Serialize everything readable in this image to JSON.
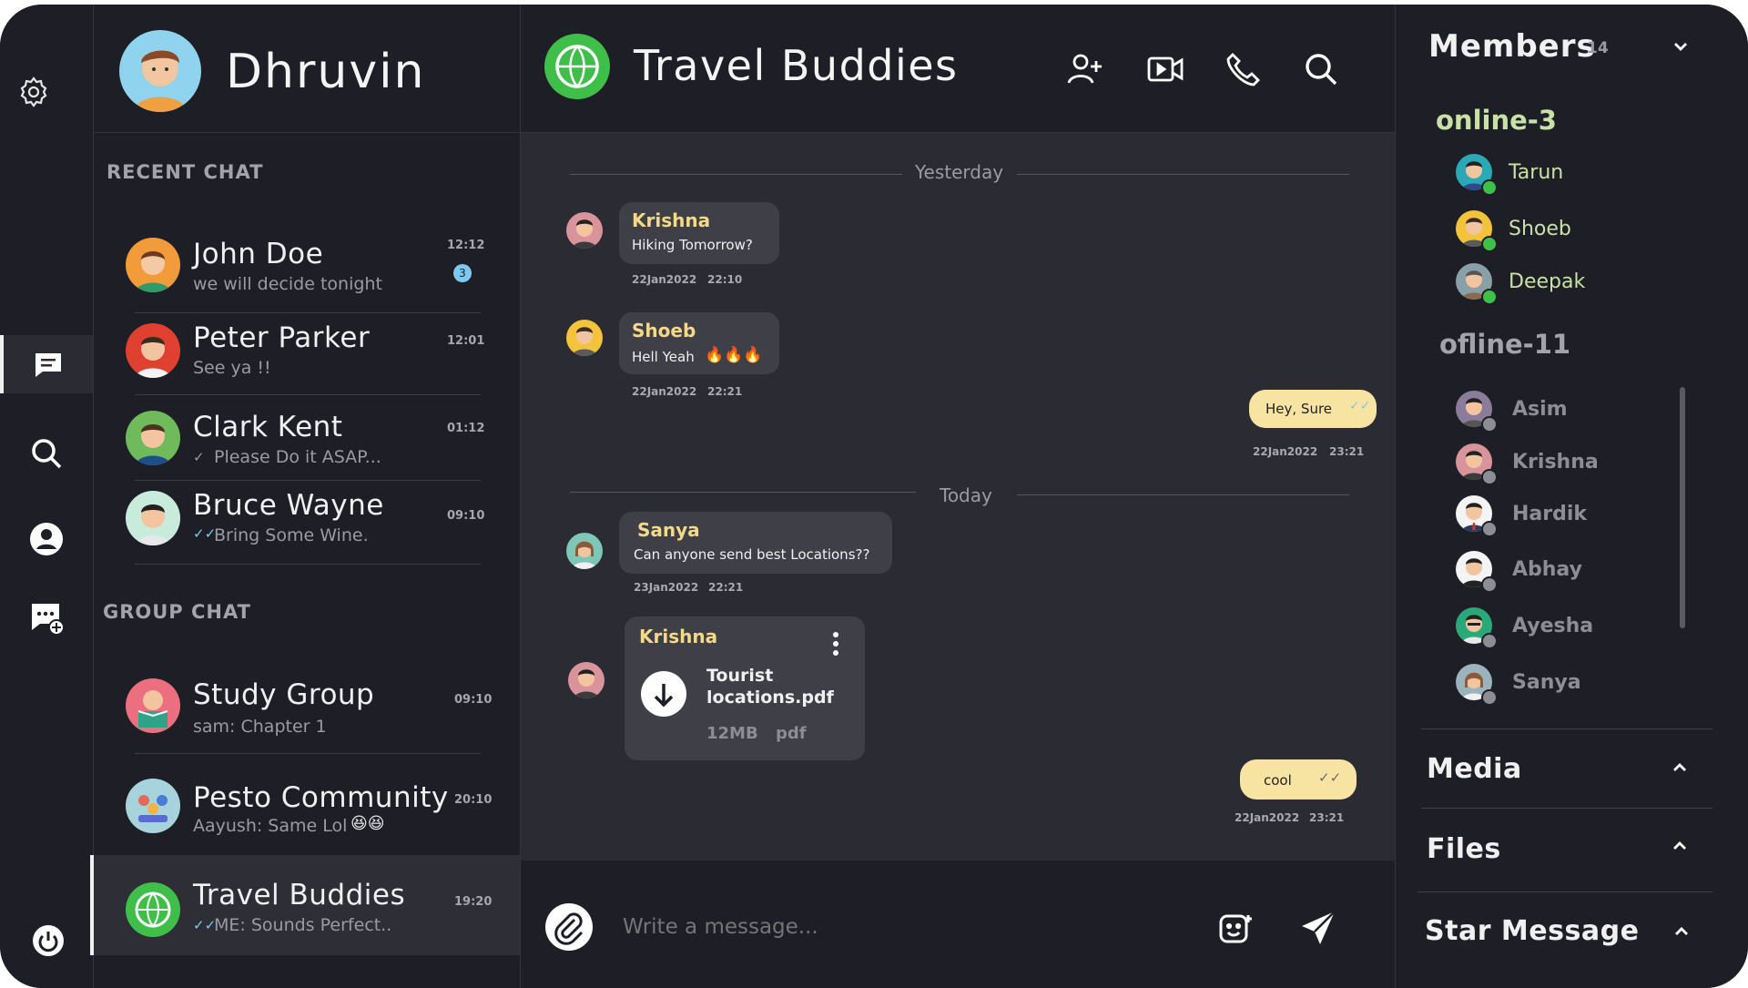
{
  "user": {
    "name": "Dhruvin"
  },
  "recent_chat": {
    "title": "RECENT CHAT",
    "items": [
      {
        "name": "John Doe",
        "preview": "we will decide tonight",
        "time": "12:12",
        "unread": "3"
      },
      {
        "name": "Peter Parker",
        "preview": "See ya !!",
        "time": "12:01"
      },
      {
        "name": "Clark Kent",
        "preview": "Please Do it ASAP...",
        "time": "01:12"
      },
      {
        "name": "Bruce Wayne",
        "preview": "Bring Some Wine.",
        "time": "09:10"
      }
    ]
  },
  "group_chat": {
    "title": "GROUP CHAT",
    "items": [
      {
        "name": "Study Group",
        "preview": "sam: Chapter 1",
        "time": "09:10"
      },
      {
        "name": "Pesto Community",
        "preview": "Aayush: Same Lol",
        "time": "20:10"
      },
      {
        "name": "Travel Buddies",
        "preview": "ME: Sounds Perfect..",
        "time": "19:20"
      }
    ]
  },
  "conversation": {
    "title": "Travel Buddies",
    "divider_yesterday": "Yesterday",
    "divider_today": "Today",
    "messages": [
      {
        "sender": "Krishna",
        "text": "Hiking Tomorrow?",
        "date": "22Jan2022",
        "time": "22:10"
      },
      {
        "sender": "Shoeb",
        "text": "Hell Yeah",
        "date": "22Jan2022",
        "time": "22:21"
      },
      {
        "text": "Hey, Sure",
        "date": "22Jan2022",
        "time": "23:21"
      },
      {
        "sender": "Sanya",
        "text": "Can anyone send best Locations??",
        "date": "23Jan2022",
        "time": "22:21"
      },
      {
        "sender": "Krishna",
        "file_name_1": "Tourist",
        "file_name_2": "locations.pdf",
        "size": "12MB",
        "type": "pdf"
      },
      {
        "text": "cool",
        "date": "22Jan2022",
        "time": "23:21"
      }
    ],
    "composer_placeholder": "Write a message..."
  },
  "members": {
    "title": "Members",
    "count": "14",
    "online_title": "online-3",
    "online": [
      "Tarun",
      "Shoeb",
      "Deepak"
    ],
    "offline_title": "ofline-11",
    "offline": [
      "Asim",
      "Krishna",
      "Hardik",
      "Abhay",
      "Ayesha",
      "Sanya"
    ],
    "sections": [
      "Media",
      "Files",
      "Star Message"
    ]
  },
  "colors": {
    "background": "#1e1f26",
    "panel": "#2b2c33",
    "bubble": "#3e3f47",
    "mine": "#f8e4a2",
    "sender": "#f5d98a",
    "online": "#3ec14a"
  }
}
